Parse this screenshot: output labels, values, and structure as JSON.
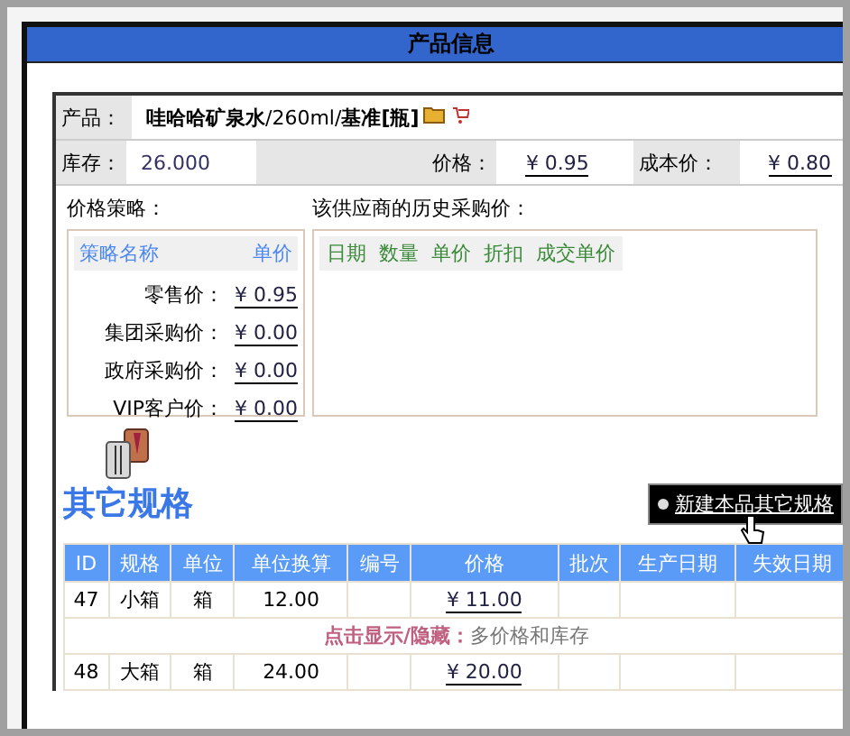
{
  "dialog": {
    "title": "产品信息"
  },
  "product": {
    "label": "产品：",
    "name": "**哇哈哈矿泉水**/260ml/**基准[瓶]**"
  },
  "info_row": [
    {
      "label": "库存：",
      "value": "26.000",
      "kind": "plain"
    },
    {
      "label": "价格：",
      "value": "¥ 0.95",
      "kind": "money"
    },
    {
      "label": "成本价：",
      "value": "¥ 0.80",
      "kind": "money"
    }
  ],
  "price_strategy": {
    "title": "价格策略：",
    "columns": [
      "策略名称",
      "单价"
    ],
    "rows": [
      {
        "label": "零售价：",
        "value": "¥ 0.95"
      },
      {
        "label": "集团采购价：",
        "value": "¥ 0.00"
      },
      {
        "label": "政府采购价：",
        "value": "¥ 0.00"
      },
      {
        "label": "VIP客户价：",
        "value": "¥ 0.00"
      }
    ]
  },
  "history": {
    "title": "该供应商的历史采购价：",
    "columns": [
      "日期",
      "数量",
      "单价",
      "折扣",
      "成交单价"
    ]
  },
  "other_specs": {
    "title": "其它规格",
    "new_link": "新建本品其它规格",
    "columns": [
      "ID",
      "规格",
      "单位",
      "单位换算",
      "编号",
      "价格",
      "批次",
      "生产日期",
      "失效日期"
    ],
    "rows": [
      {
        "cells": [
          "47",
          "小箱",
          "箱",
          "12.00",
          "",
          "¥ 11.00",
          "",
          "",
          ""
        ]
      },
      {
        "cells": [
          "48",
          "大箱",
          "箱",
          "24.00",
          "",
          "¥ 20.00",
          "",
          "",
          ""
        ]
      }
    ],
    "toggle": {
      "label": "点击显示/隐藏：",
      "text": "多价格和库存"
    }
  }
}
